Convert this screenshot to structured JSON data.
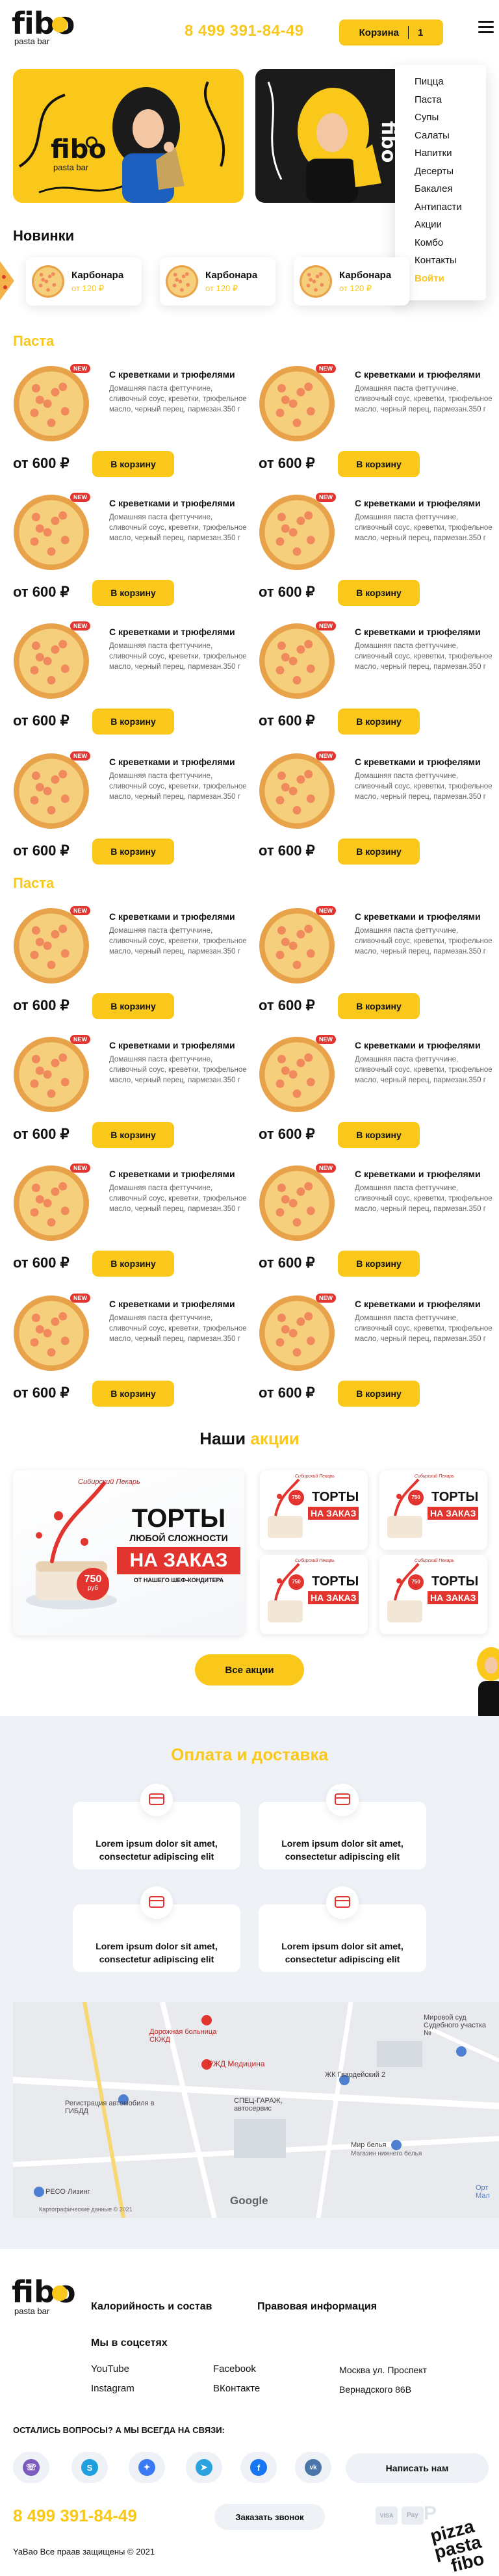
{
  "header": {
    "logo_top": "fibo",
    "logo_bottom": "pasta bar",
    "phone": "8 499 391-84-49",
    "cart_label": "Корзина",
    "cart_count": "1"
  },
  "menu": [
    "Пицца",
    "Паста",
    "Супы",
    "Салаты",
    "Напитки",
    "Десерты",
    "Бакалея",
    "Антипасти",
    "Акции",
    "Комбо",
    "Контакты"
  ],
  "menu_login": "Войти",
  "banner": {
    "logo_top": "fibo",
    "logo_bottom": "pasta bar"
  },
  "new_section": {
    "title": "Новинки",
    "items": [
      {
        "name": "Карбонара",
        "price": "от 120 ₽"
      },
      {
        "name": "Карбонара",
        "price": "от 120 ₽"
      },
      {
        "name": "Карбонара",
        "price": "от 120 ₽"
      }
    ]
  },
  "pasta_title": "Паста",
  "product": {
    "name": "С креветками и трюфелями",
    "desc": "Домашняя паста феттуччине, сливочный соус, креветки, трюфельное масло, черный перец, пармезан.350 г",
    "price": "от 600 ₽",
    "buy": "В корзину",
    "badge": "NEW"
  },
  "promos": {
    "title_a": "Наши",
    "title_b": "акции",
    "brand": "Сибирский Пекарь",
    "main_title": "ТОРТЫ",
    "main_sub": "ЛЮБОЙ СЛОЖНОСТИ",
    "main_title2": "НА ЗАКАЗ",
    "main_sub2": "ОТ НАШЕГО ШЕФ-КОНДИТЕРА",
    "price_tag": "750",
    "price_unit": "руб",
    "small_t1": "ТОРТЫ",
    "small_t2": "НА ЗАКАЗ",
    "all_button": "Все акции"
  },
  "delivery": {
    "title": "Оплата и доставка",
    "cards": [
      {
        "text": "Lorem ipsum dolor sit amet, consectetur adipiscing elit",
        "icon": "card-icon"
      },
      {
        "text": "Lorem ipsum dolor sit amet, consectetur adipiscing elit",
        "icon": "truck-icon"
      },
      {
        "text": "Lorem ipsum dolor sit amet, consectetur adipiscing elit",
        "icon": "laptop-icon"
      },
      {
        "text": "Lorem ipsum dolor sit amet, consectetur adipiscing elit",
        "icon": "scooter-icon"
      }
    ]
  },
  "map": {
    "labels": [
      "Дорожная больница СКЖД",
      "Регистрация автомобиля в ГИБДД",
      "РЖД Медицина",
      "СПЕЦ-ГАРАЖ, автосервис",
      "ЖК Гвардейский 2",
      "Мир белья",
      "Магазин нижнего белья",
      "Мировой суд Судебного участка №",
      "РЕСО Лизинг",
      "Орт Мал"
    ],
    "google": "Google",
    "terms": "Картографические данные © 2021"
  },
  "footer": {
    "logo_top": "fibo",
    "logo_bottom": "pasta bar",
    "calories": "Калорийность и состав",
    "legal": "Правовая информация",
    "social_title": "Мы в соцсетях",
    "youtube": "YouTube",
    "facebook": "Facebook",
    "instagram": "Instagram",
    "vk": "ВКонтакте",
    "address1": "Москва ул. Проспект",
    "address2": "Вернадского 86В",
    "contact_title": "ОСТАЛИСЬ ВОПРОСЫ? А МЫ ВСЕГДА НА СВЯЗИ:",
    "write_label": "Написать нам",
    "phone": "8 499 391-84-49",
    "callback": "Заказать звонок",
    "copyright": "YaBao Все праав защищены © 2021",
    "pay_badges": [
      "VISA",
      "Pay",
      "P"
    ],
    "deco_words": [
      "pizza",
      "pasta",
      "fibo"
    ]
  },
  "colors": {
    "accent": "#f9c81a",
    "red": "#e2352f",
    "bg_light": "#eef2f7"
  }
}
